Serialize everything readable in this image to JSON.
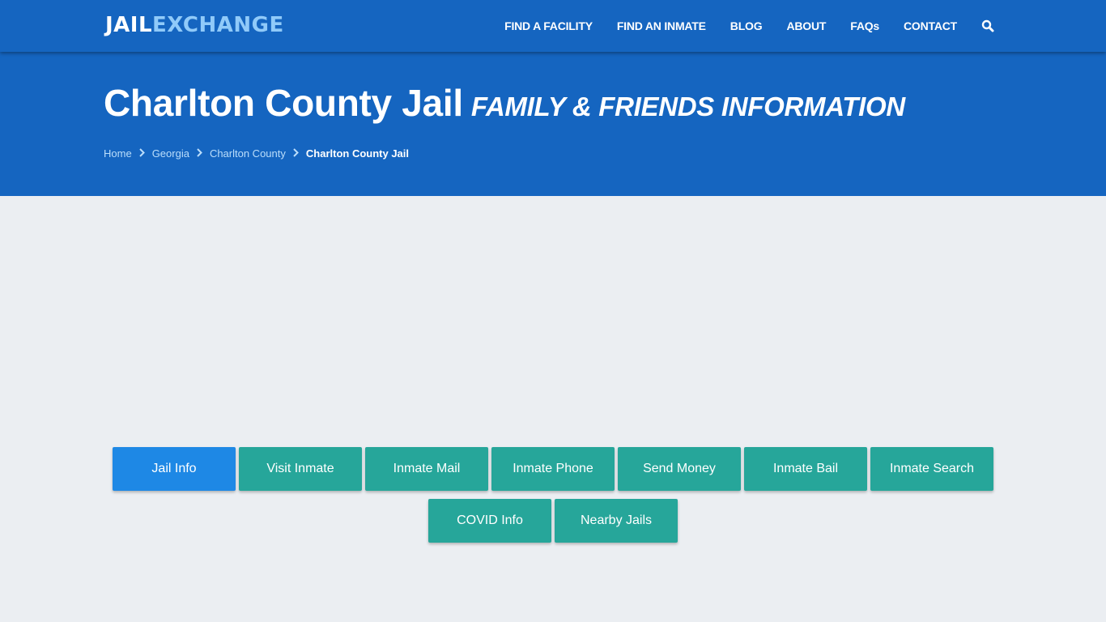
{
  "header": {
    "logo": {
      "part1": "JAIL",
      "part2": "EXCHANGE"
    },
    "nav": [
      {
        "label": "FIND A FACILITY"
      },
      {
        "label": "FIND AN INMATE"
      },
      {
        "label": "BLOG"
      },
      {
        "label": "ABOUT"
      },
      {
        "label": "FAQs"
      },
      {
        "label": "CONTACT"
      }
    ],
    "search_icon": "search-icon"
  },
  "hero": {
    "title": "Charlton County Jail",
    "subtitle": "FAMILY & FRIENDS INFORMATION",
    "breadcrumb": [
      {
        "label": "Home"
      },
      {
        "label": "Georgia"
      },
      {
        "label": "Charlton County"
      },
      {
        "label": "Charlton County Jail"
      }
    ],
    "breadcrumb_separator_icon": "chevron-right-icon"
  },
  "colors": {
    "brand_blue": "#1565c0",
    "logo_accent": "#90caf9",
    "active_button": "#1e88e5",
    "button": "#26a69a",
    "page_bg": "#ebeef2"
  },
  "buttons": [
    {
      "label": "Jail Info",
      "active": true
    },
    {
      "label": "Visit Inmate"
    },
    {
      "label": "Inmate Mail"
    },
    {
      "label": "Inmate Phone"
    },
    {
      "label": "Send Money"
    },
    {
      "label": "Inmate Bail"
    },
    {
      "label": "Inmate Search"
    },
    {
      "label": "COVID Info"
    },
    {
      "label": "Nearby Jails"
    }
  ]
}
